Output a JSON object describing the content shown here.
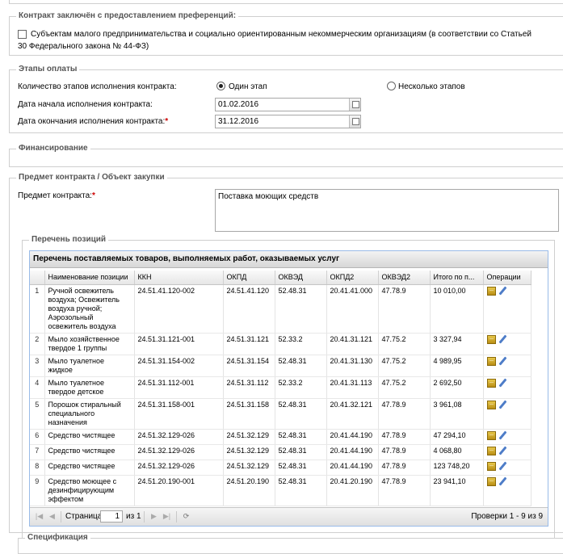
{
  "preferences": {
    "legend": "Контракт заключён с предоставлением преференций:",
    "checkbox_label_line1": "Субъектам малого предпринимательства и социально ориентированным некоммерческим организациям (в соответствии со Статьей",
    "checkbox_label_line2": "30 Федерального закона № 44-ФЗ)",
    "checked": false
  },
  "payment": {
    "legend": "Этапы оплаты",
    "stages_label": "Количество этапов исполнения контракта:",
    "radio_one": "Один этап",
    "radio_many": "Несколько этапов",
    "start_label": "Дата начала исполнения контракта:",
    "start_value": "01.02.2016",
    "end_label": "Дата окончания исполнения контракта:",
    "end_value": "31.12.2016",
    "required_mark": "*"
  },
  "financing": {
    "legend": "Финансирование"
  },
  "subject": {
    "legend": "Предмет контракта / Объект закупки",
    "label": "Предмет контракта:",
    "value": "Поставка моющих средств"
  },
  "positions": {
    "legend": "Перечень позиций",
    "grid_title": "Перечень поставляемых товаров, выполняемых работ, оказываемых услуг",
    "columns": [
      "Наименование позиции",
      "ККН",
      "ОКПД",
      "ОКВЭД",
      "ОКПД2",
      "ОКВЭД2",
      "Итого по п...",
      "Операции"
    ],
    "rows": [
      {
        "n": "1",
        "name": "Ручной освежитель воздуха; Освежитель воздуха ручной; Аэрозольный освежитель воздуха",
        "kkn": "24.51.41.120-002",
        "okpd": "24.51.41.120",
        "okved": "52.48.31",
        "okpd2": "20.41.41.000",
        "okved2": "47.78.9",
        "total": "10 010,00"
      },
      {
        "n": "2",
        "name": "Мыло хозяйственное твердое 1 группы",
        "kkn": "24.51.31.121-001",
        "okpd": "24.51.31.121",
        "okved": "52.33.2",
        "okpd2": "20.41.31.121",
        "okved2": "47.75.2",
        "total": "3 327,94"
      },
      {
        "n": "3",
        "name": "Мыло туалетное жидкое",
        "kkn": "24.51.31.154-002",
        "okpd": "24.51.31.154",
        "okved": "52.48.31",
        "okpd2": "20.41.31.130",
        "okved2": "47.75.2",
        "total": "4 989,95"
      },
      {
        "n": "4",
        "name": "Мыло туалетное твердое детское",
        "kkn": "24.51.31.112-001",
        "okpd": "24.51.31.112",
        "okved": "52.33.2",
        "okpd2": "20.41.31.113",
        "okved2": "47.75.2",
        "total": "2 692,50"
      },
      {
        "n": "5",
        "name": "Порошок стиральный специального назначения",
        "kkn": "24.51.31.158-001",
        "okpd": "24.51.31.158",
        "okved": "52.48.31",
        "okpd2": "20.41.32.121",
        "okved2": "47.78.9",
        "total": "3 961,08"
      },
      {
        "n": "6",
        "name": "Средство чистящее",
        "kkn": "24.51.32.129-026",
        "okpd": "24.51.32.129",
        "okved": "52.48.31",
        "okpd2": "20.41.44.190",
        "okved2": "47.78.9",
        "total": "47 294,10"
      },
      {
        "n": "7",
        "name": "Средство чистящее",
        "kkn": "24.51.32.129-026",
        "okpd": "24.51.32.129",
        "okved": "52.48.31",
        "okpd2": "20.41.44.190",
        "okved2": "47.78.9",
        "total": "4 068,80"
      },
      {
        "n": "8",
        "name": "Средство чистящее",
        "kkn": "24.51.32.129-026",
        "okpd": "24.51.32.129",
        "okved": "52.48.31",
        "okpd2": "20.41.44.190",
        "okved2": "47.78.9",
        "total": "123 748,20"
      },
      {
        "n": "9",
        "name": "Средство моющее с дезинфицирующим эффектом",
        "kkn": "24.51.20.190-001",
        "okpd": "24.51.20.190",
        "okved": "52.48.31",
        "okpd2": "20.41.20.190",
        "okved2": "47.78.9",
        "total": "23 941,10"
      }
    ],
    "pager": {
      "page_label": "Страница",
      "page_value": "1",
      "of_label": "из 1",
      "summary": "Проверки 1 - 9 из 9"
    }
  },
  "specification": {
    "legend": "Спецификация"
  }
}
